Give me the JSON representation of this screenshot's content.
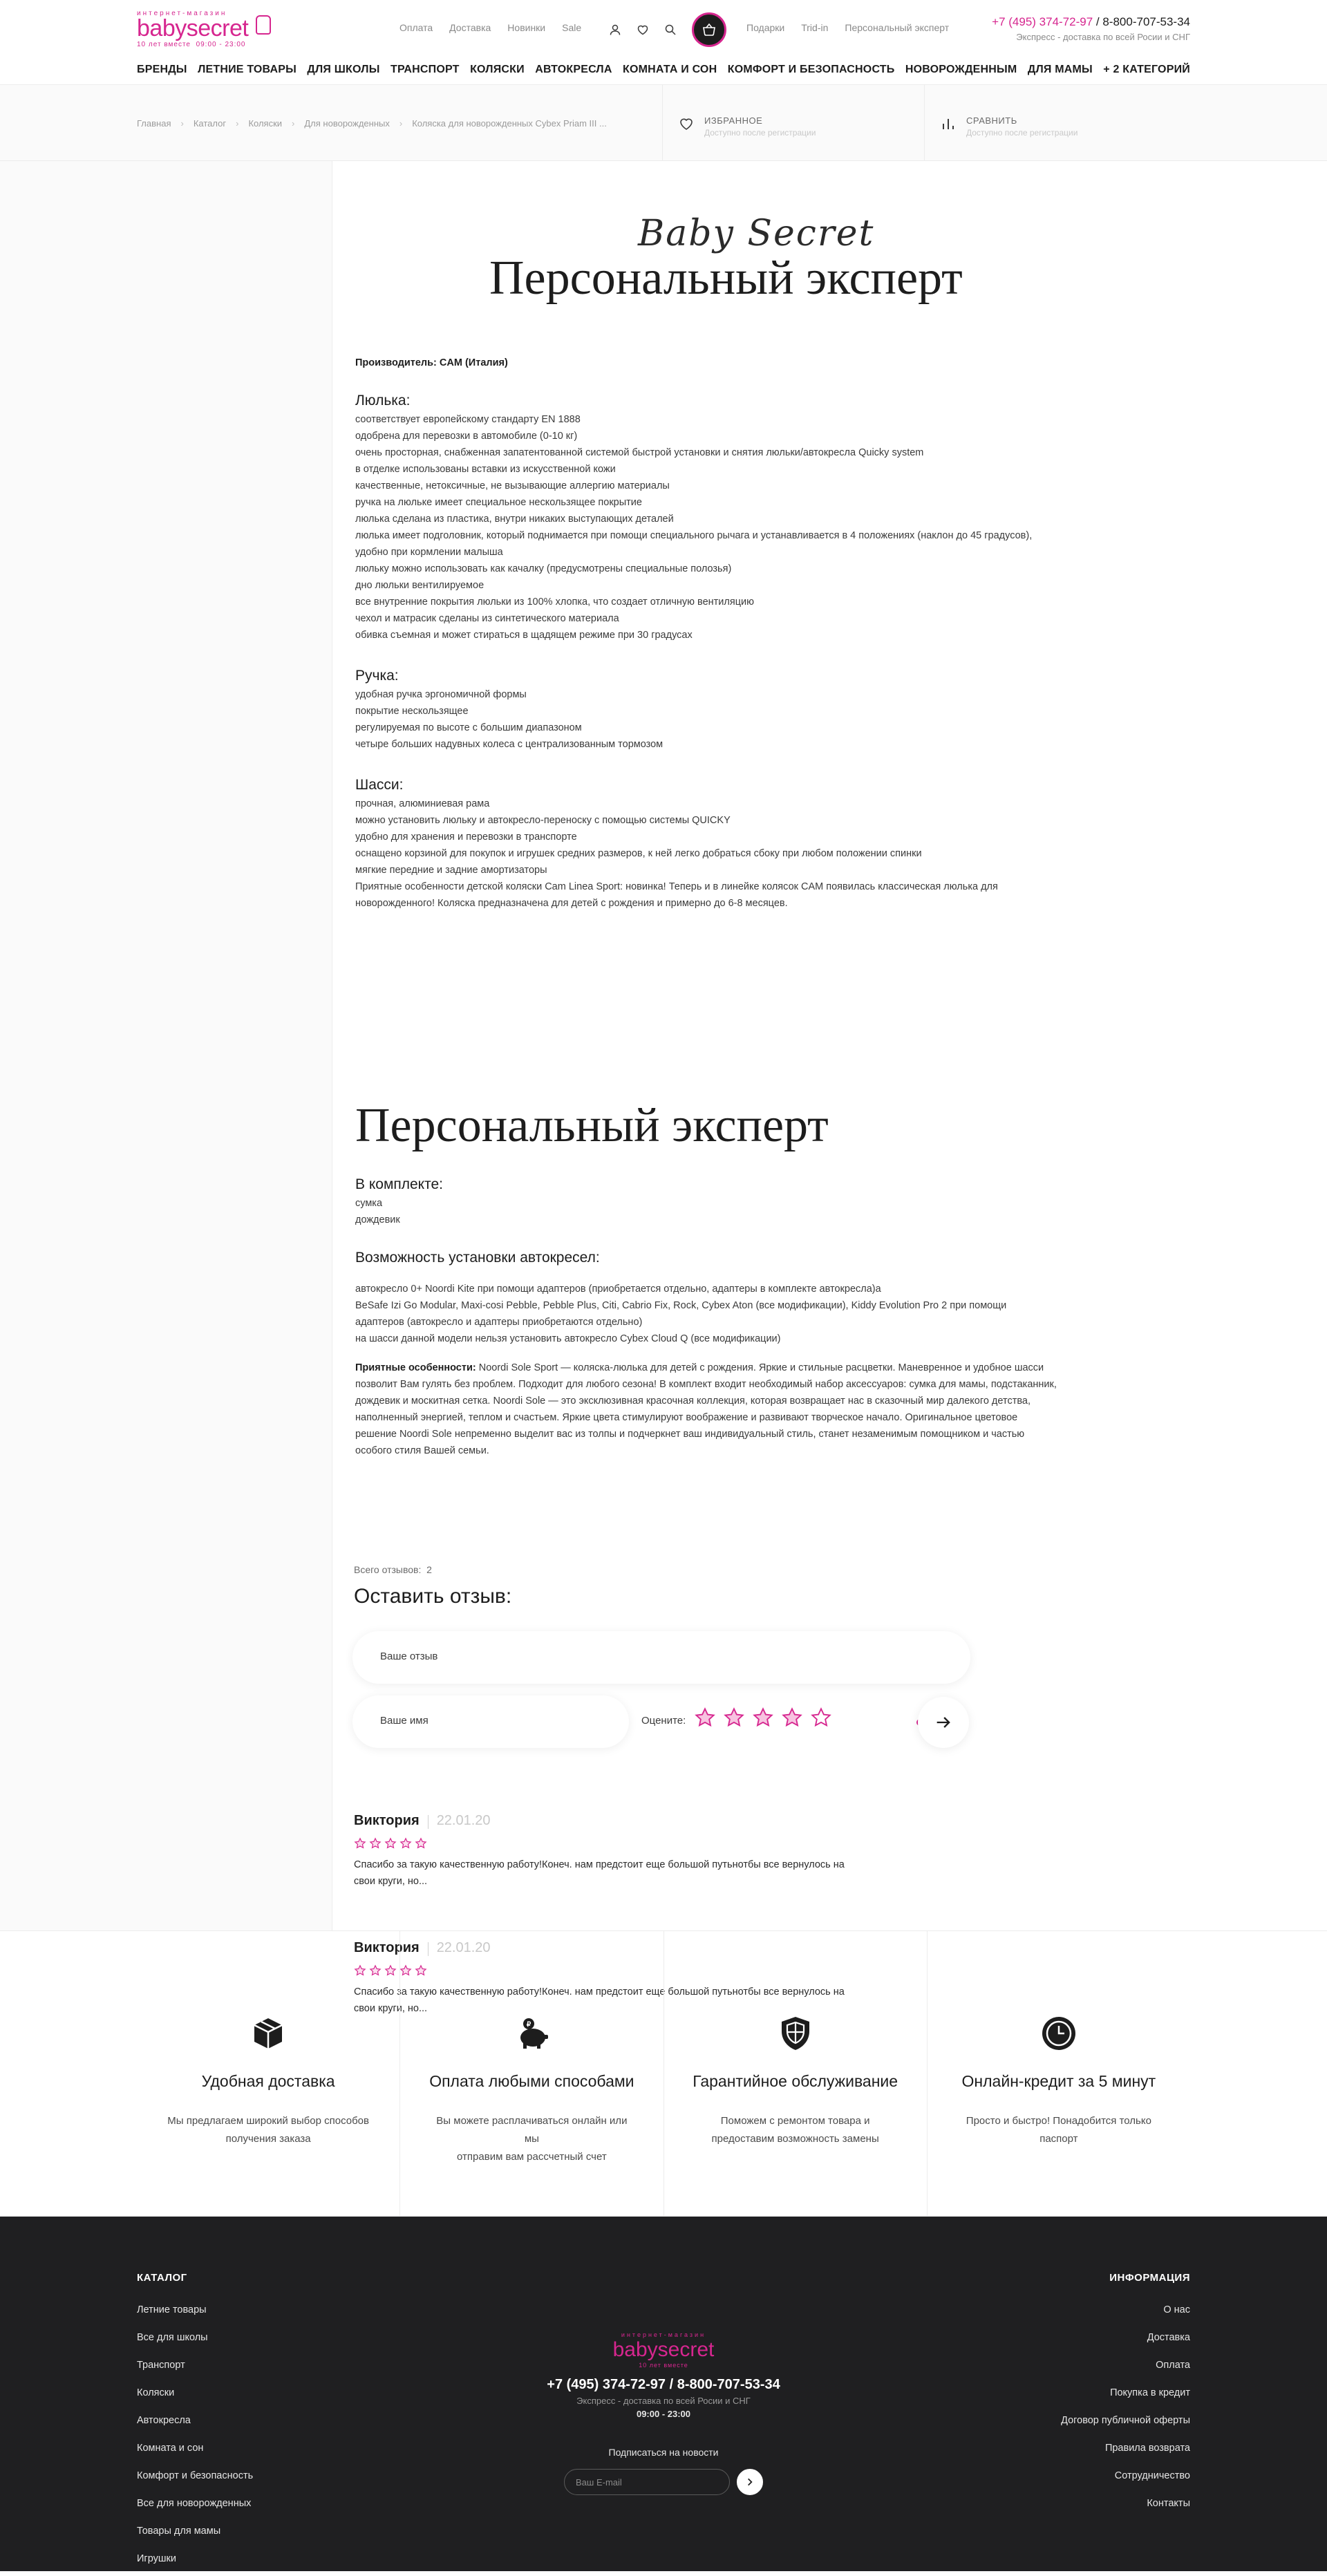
{
  "header": {
    "logo_top": "интернет-магазин",
    "logo_name": "babysecret",
    "logo_years": "10 лет вместе",
    "logo_hours": "09:00 - 23:00",
    "links_left": [
      "Оплата",
      "Доставка",
      "Новинки",
      "Sale"
    ],
    "links_right": [
      "Подарки",
      "Trid-in",
      "Персональный эксперт"
    ],
    "phone1": "+7 (495) 374-72-97",
    "phone_sep": " / ",
    "phone2": "8-800-707-53-34",
    "delivery": "Экспресс - доставка по всей Росии и СНГ"
  },
  "nav": [
    "БРЕНДЫ",
    "ЛЕТНИЕ ТОВАРЫ",
    "ДЛЯ ШКОЛЫ",
    "ТРАНСПОРТ",
    "КОЛЯСКИ",
    "АВТОКРЕСЛА",
    "КОМНАТА И СОН",
    "КОМФОРТ И БЕЗОПАСНОСТЬ",
    "НОВОРОЖДЕННЫМ",
    "ДЛЯ МАМЫ",
    "+ 2 КАТЕГОРИЙ"
  ],
  "breadcrumbs": [
    "Главная",
    "Каталог",
    "Коляски",
    "Для новорожденных",
    "Коляска для новорожденных Cybex Priam III ..."
  ],
  "favorites": {
    "title": "ИЗБРАННОЕ",
    "sub": "Доступно после регистрации"
  },
  "compare": {
    "title": "СРАВНИТЬ",
    "sub": "Доступно после регистрации"
  },
  "content": {
    "script_logo": "Baby Secret",
    "title": "Персональный эксперт",
    "manufacturer": "Производитель: CAM (Италия)",
    "sections": [
      {
        "heading": "Люлька:",
        "lines": [
          "соответствует европейскому стандарту EN 1888",
          "одобрена для перевозки в автомобиле (0-10 кг)",
          "очень просторная, снабженная запатентованной системой быстрой установки и снятия люльки/автокресла Quicky system",
          "в отделке использованы вставки из искусственной кожи",
          "качественные, нетоксичные, не вызывающие аллергию материалы",
          "ручка на люльке имеет специальное нескользящее покрытие",
          "люлька сделана из пластика, внутри никаких выступающих деталей",
          "люлька имеет подголовник, который поднимается при помощи специального рычага и устанавливается в 4 положениях (наклон до 45 градусов),",
          "удобно при кормлении малыша",
          "люльку можно использовать как качалку (предусмотрены специальные полозья)",
          "дно люльки вентилируемое",
          "все внутренние покрытия люльки из 100% хлопка, что создает отличную вентиляцию",
          "чехол и матрасик сделаны из синтетического материала",
          "обивка съемная и может стираться в щадящем режиме при 30 градусах"
        ]
      },
      {
        "heading": "Ручка:",
        "lines": [
          "удобная ручка эргономичной формы",
          "покрытие нескользящее",
          "регулируемая по высоте с большим диапазоном",
          "четыре больших надувных колеса с централизованным тормозом"
        ]
      },
      {
        "heading": "Шасси:",
        "lines": [
          "прочная, алюминиевая рама",
          "можно установить люльку и автокресло-переноску с помощью системы QUICKY",
          "удобно для хранения и перевозки в транспорте",
          "оснащено корзиной для покупок и игрушек средних размеров, к ней легко добраться сбоку при любом положении спинки",
          "мягкие передние и задние амортизаторы",
          "Приятные особенности детской коляски Cam  Linea Sport: новинка! Теперь и в линейке колясок CAM появилась классическая люлька для",
          "новорожденного! Коляска предназначена для детей с рождения и примерно до 6-8 месяцев."
        ]
      }
    ],
    "title2": "Персональный эксперт",
    "kit_heading": "В комплекте:",
    "kit_lines": [
      "сумка",
      "дождевик"
    ],
    "seats_heading": "Возможность установки автокресел:",
    "seats_lines": [
      "автокресло 0+ Noordi Kite при помощи адаптеров (приобретается отдельно, адаптеры в комплекте автокресла)а",
      "BeSafe Izi Go Modular, Maxi-cosi Pebble, Pebble Plus, Citi, Cabrio Fix, Rock, Cybex Aton (все модификации), Kiddy Evolution Pro 2 при помощи",
      "адаптеров (автокресло и адаптеры приобретаются отдельно)",
      "на шасси данной модели нельзя установить автокресло Cybex Cloud Q (все модификации)"
    ],
    "features_label": "Приятные особенности:",
    "features_lines": [
      " Noordi Sole Sport — коляска-люлька для детей с рождения. Яркие и стильные расцветки. Маневренное и удобное шасси",
      "позволит Вам гулять без проблем. Подходит для любого сезона! В комплект входит необходимый набор аксессуаров: сумка для мамы, подстаканник,",
      "дождевик и москитная сетка. Noordi Sole — это эксклюзивная красочная коллекция, которая возвращает нас в сказочный мир далекого детства,",
      "наполненный энергией, теплом и счастьем. Яркие цвета стимулируют воображение и развивают творческое начало. Оригинальное цветовое",
      "решение Noordi Sole непременно выделит вас из толпы и подчеркнет ваш индивидуальный стиль, станет незаменимым помощником и частью",
      "особого стиля Вашей семьи."
    ]
  },
  "reviews": {
    "count_label": "Всего отзывов:",
    "count": "2",
    "form_title": "Оставить отзыв:",
    "review_placeholder": "Ваше отзыв",
    "name_placeholder": "Ваше имя",
    "rate_label": "Оцените:",
    "items": [
      {
        "name": "Виктория",
        "date": "22.01.20",
        "rating": 5,
        "text1": "Спасибо за  такую качественную работу!Конеч. нам предстоит еще большой путьнотбы все вернулось на",
        "text2": "свои круги, но..."
      },
      {
        "name": "Виктория",
        "date": "22.01.20",
        "rating": 5,
        "text1": "Спасибо за  такую качественную работу!Конеч. нам предстоит еще большой путьнотбы все вернулось на",
        "text2": "свои круги, но..."
      }
    ]
  },
  "features": [
    {
      "icon": "box-icon",
      "title": "Удобная доставка",
      "line1": "Мы предлагаем широкий выбор способов",
      "line2": "получения заказа"
    },
    {
      "icon": "piggy-bank-icon",
      "title": "Оплата любыми способами",
      "line1": "Вы можете расплачиваться онлайн или мы",
      "line2": "отправим вам рассчетный счет"
    },
    {
      "icon": "shield-icon",
      "title": "Гарантийное обслуживание",
      "line1": "Поможем с ремонтом товара и",
      "line2": "предоставим возможность замены"
    },
    {
      "icon": "clock-icon",
      "title": "Онлайн-кредит за 5 минут",
      "line1": "Просто и быстро! Понадобится только",
      "line2": "паспорт"
    }
  ],
  "footer": {
    "catalog_title": "КАТАЛОГ",
    "catalog": [
      "Летние товары",
      "Все для школы",
      "Транспорт",
      "Коляски",
      "Автокресла",
      "Комната и сон",
      "Комфорт и безопасность",
      "Все для новорожденных",
      "Товары для мамы",
      "Игрушки"
    ],
    "info_title": "ИНФОРМАЦИЯ",
    "info": [
      "О нас",
      "Доставка",
      "Оплата",
      "Покупка в кредит",
      "Договор публичной оферты",
      "Правила возврата",
      "Сотрудничество",
      "Контакты"
    ],
    "phone": "+7 (495) 374-72-97 / 8-800-707-53-34",
    "delivery": "Экспресс - доставка по всей Росии и СНГ",
    "hours": "09:00 - 23:00",
    "subscribe": "Подписаться на новости",
    "email_placeholder": "Ваш E-mail"
  },
  "colors": {
    "accent": "#d6268f",
    "footer_bg": "#1f1f21",
    "dark": "#1d1d1d"
  }
}
